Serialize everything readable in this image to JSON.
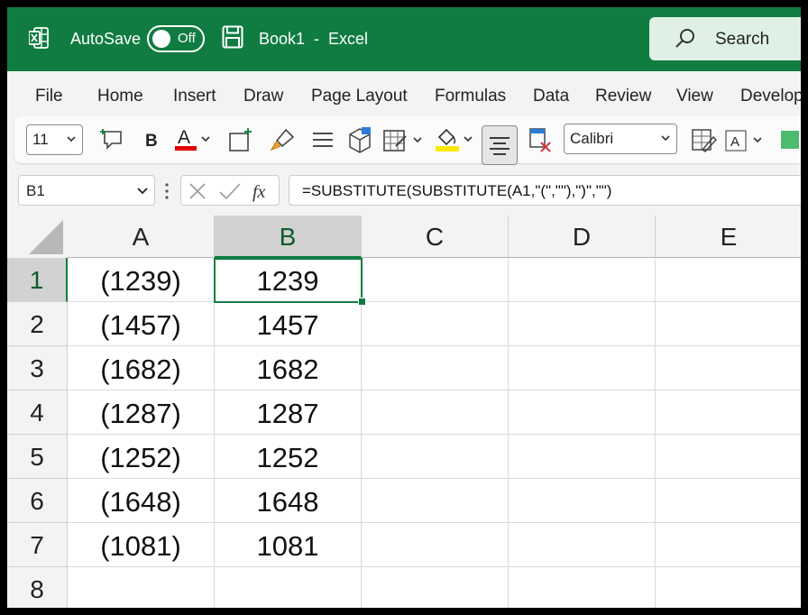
{
  "title_bar": {
    "autosave_label": "AutoSave",
    "autosave_state": "Off",
    "document_title": "Book1  -  Excel",
    "search_placeholder": "Search",
    "accent": "#107c41"
  },
  "menu": {
    "items": [
      "File",
      "Home",
      "Insert",
      "Draw",
      "Page Layout",
      "Formulas",
      "Data",
      "Review",
      "View",
      "Develop"
    ]
  },
  "ribbon": {
    "font_size": "11",
    "font_name": "Calibri",
    "icons": [
      "new-comment-icon",
      "bold-icon",
      "font-color-icon",
      "insert-cells-icon",
      "format-painter-icon",
      "align-icon",
      "3d-box-icon",
      "borders-icon",
      "fill-color-icon",
      "center-align-icon",
      "clear-format-icon",
      "cell-styles-icon",
      "font-a-icon",
      "fill-green-icon"
    ]
  },
  "formula_bar": {
    "name_box": "B1",
    "formula": "=SUBSTITUTE(SUBSTITUTE(A1,\"(\",\"\"),\")\",\"\")"
  },
  "grid": {
    "columns": [
      "A",
      "B",
      "C",
      "D",
      "E"
    ],
    "selected_column": "B",
    "rows": [
      "1",
      "2",
      "3",
      "4",
      "5",
      "6",
      "7",
      "8"
    ],
    "selected_row": "1",
    "data": [
      [
        "(1239)",
        "1239"
      ],
      [
        "(1457)",
        "1457"
      ],
      [
        "(1682)",
        "1682"
      ],
      [
        "(1287)",
        "1287"
      ],
      [
        "(1252)",
        "1252"
      ],
      [
        "(1648)",
        "1648"
      ],
      [
        "(1081)",
        "1081"
      ],
      [
        "",
        ""
      ]
    ],
    "active_cell": "B1"
  }
}
